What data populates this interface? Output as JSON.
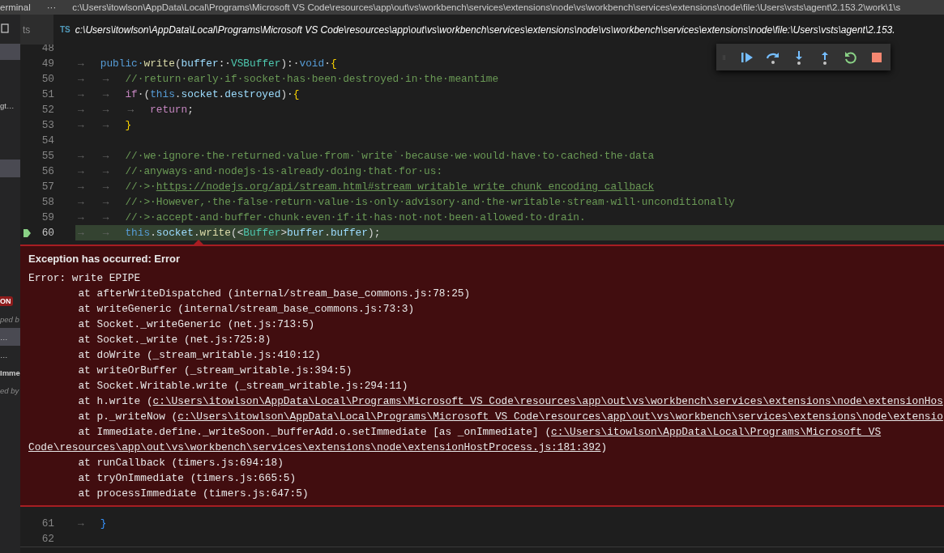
{
  "title_bar": {
    "panel_label": "erminal",
    "more": "···",
    "path": "c:\\Users\\itowlson\\AppData\\Local\\Programs\\Microsoft VS Code\\resources\\app\\out\\vs\\workbench\\services\\extensions\\node\\vs\\workbench\\services\\extensions\\node\\file:\\Users\\vsts\\agent\\2.153.2\\work\\1\\s"
  },
  "sidebar": [
    {
      "kind": "row",
      "selected": true
    },
    {
      "kind": "text",
      "text": "gt…",
      "selected": false
    },
    {
      "kind": "row",
      "selected": true
    },
    {
      "kind": "badge",
      "text": "ON",
      "selected": false
    },
    {
      "kind": "note",
      "text": "ped b",
      "selected": false
    },
    {
      "kind": "text",
      "text": "…",
      "selected": true
    },
    {
      "kind": "text",
      "text": "…",
      "selected": false
    },
    {
      "kind": "strong",
      "text": "Imme",
      "selected": false
    },
    {
      "kind": "note",
      "text": "ed by",
      "selected": false
    }
  ],
  "tabs": [
    {
      "label": "ts",
      "selected": false
    },
    {
      "badge": "TS",
      "label": "c:\\Users\\itowlson\\AppData\\Local\\Programs\\Microsoft VS Code\\resources\\app\\out\\vs\\workbench\\services\\extensions\\node\\vs\\workbench\\services\\extensions\\node\\file:\\Users\\vsts\\agent\\2.153.",
      "selected": true
    }
  ],
  "code_before": [
    {
      "number": "48",
      "current": false
    },
    {
      "number": "49",
      "current": false,
      "tokens": [
        {
          "kind": "tab",
          "text": "→"
        },
        {
          "kind": "keyword",
          "text": "public·"
        },
        {
          "kind": "function",
          "text": "write"
        },
        {
          "kind": "plain",
          "text": "("
        },
        {
          "kind": "variable",
          "text": "buffer"
        },
        {
          "kind": "plain",
          "text": ":·"
        },
        {
          "kind": "type",
          "text": "VSBuffer"
        },
        {
          "kind": "plain",
          "text": "):·"
        },
        {
          "kind": "keyword",
          "text": "void"
        },
        {
          "kind": "plain",
          "text": "·"
        },
        {
          "kind": "brace",
          "text": "{"
        }
      ]
    },
    {
      "number": "50",
      "current": false,
      "tokens": [
        {
          "kind": "tab",
          "text": "→"
        },
        {
          "kind": "tab",
          "text": "→"
        },
        {
          "kind": "comment",
          "text": "//·return·early·if·socket·has·been·destroyed·in·the·meantime"
        }
      ]
    },
    {
      "number": "51",
      "current": false,
      "tokens": [
        {
          "kind": "tab",
          "text": "→"
        },
        {
          "kind": "tab",
          "text": "→"
        },
        {
          "kind": "control",
          "text": "if"
        },
        {
          "kind": "plain",
          "text": "·("
        },
        {
          "kind": "keyword",
          "text": "this"
        },
        {
          "kind": "plain",
          "text": "."
        },
        {
          "kind": "variable",
          "text": "socket"
        },
        {
          "kind": "plain",
          "text": "."
        },
        {
          "kind": "variable",
          "text": "destroyed"
        },
        {
          "kind": "plain",
          "text": ")·"
        },
        {
          "kind": "brace",
          "text": "{"
        }
      ]
    },
    {
      "number": "52",
      "current": false,
      "tokens": [
        {
          "kind": "tab",
          "text": "→"
        },
        {
          "kind": "tab",
          "text": "→"
        },
        {
          "kind": "tab",
          "text": "→"
        },
        {
          "kind": "control",
          "text": "return"
        },
        {
          "kind": "plain",
          "text": ";"
        }
      ]
    },
    {
      "number": "53",
      "current": false,
      "tokens": [
        {
          "kind": "tab",
          "text": "→"
        },
        {
          "kind": "tab",
          "text": "→"
        },
        {
          "kind": "brace",
          "text": "}"
        }
      ]
    },
    {
      "number": "54",
      "current": false
    },
    {
      "number": "55",
      "current": false,
      "tokens": [
        {
          "kind": "tab",
          "text": "→"
        },
        {
          "kind": "tab",
          "text": "→"
        },
        {
          "kind": "comment",
          "text": "//·we·ignore·the·returned·value·from·`write`·because·we·would·have·to·cached·the·data"
        }
      ]
    },
    {
      "number": "56",
      "current": false,
      "tokens": [
        {
          "kind": "tab",
          "text": "→"
        },
        {
          "kind": "tab",
          "text": "→"
        },
        {
          "kind": "comment",
          "text": "//·anyways·and·nodejs·is·already·doing·that·for·us:"
        }
      ]
    },
    {
      "number": "57",
      "current": false,
      "tokens": [
        {
          "kind": "tab",
          "text": "→"
        },
        {
          "kind": "tab",
          "text": "→"
        },
        {
          "kind": "comment",
          "text": "//·>·"
        },
        {
          "kind": "link",
          "text": "https://nodejs.org/api/stream.html#stream_writable_write_chunk_encoding_callback"
        }
      ]
    },
    {
      "number": "58",
      "current": false,
      "tokens": [
        {
          "kind": "tab",
          "text": "→"
        },
        {
          "kind": "tab",
          "text": "→"
        },
        {
          "kind": "comment",
          "text": "//·>·However,·the·false·return·value·is·only·advisory·and·the·writable·stream·will·unconditionally"
        }
      ]
    },
    {
      "number": "59",
      "current": false,
      "tokens": [
        {
          "kind": "tab",
          "text": "→"
        },
        {
          "kind": "tab",
          "text": "→"
        },
        {
          "kind": "comment",
          "text": "//·>·accept·and·buffer·chunk·even·if·it·has·not·not·been·allowed·to·drain."
        }
      ]
    },
    {
      "number": "60",
      "current": true,
      "tokens": [
        {
          "kind": "tab",
          "text": "→"
        },
        {
          "kind": "tab",
          "text": "→"
        },
        {
          "kind": "keyword",
          "text": "this"
        },
        {
          "kind": "plain",
          "text": "."
        },
        {
          "kind": "variable",
          "text": "socket"
        },
        {
          "kind": "plain",
          "text": "."
        },
        {
          "kind": "function",
          "text": "write"
        },
        {
          "kind": "plain",
          "text": "(<"
        },
        {
          "kind": "type",
          "text": "Buffer"
        },
        {
          "kind": "plain",
          "text": ">"
        },
        {
          "kind": "variable",
          "text": "buffer"
        },
        {
          "kind": "plain",
          "text": "."
        },
        {
          "kind": "variable",
          "text": "buffer"
        },
        {
          "kind": "plain",
          "text": ");"
        }
      ]
    }
  ],
  "exception": {
    "title": "Exception has occurred: Error",
    "lines": [
      {
        "kind": "message",
        "text": "Error: write EPIPE"
      },
      {
        "kind": "frame",
        "text": "at afterWriteDispatched (internal/stream_base_commons.js:78:25)"
      },
      {
        "kind": "frame",
        "text": "at writeGeneric (internal/stream_base_commons.js:73:3)"
      },
      {
        "kind": "frame",
        "text": "at Socket._writeGeneric (net.js:713:5)"
      },
      {
        "kind": "frame",
        "text": "at Socket._write (net.js:725:8)"
      },
      {
        "kind": "frame",
        "text": "at doWrite (_stream_writable.js:410:12)"
      },
      {
        "kind": "frame",
        "text": "at writeOrBuffer (_stream_writable.js:394:5)"
      },
      {
        "kind": "frame",
        "text": "at Socket.Writable.write (_stream_writable.js:294:11)"
      },
      {
        "kind": "frame",
        "text": "at h.write (",
        "link": "c:\\Users\\itowlson\\AppData\\Local\\Programs\\Microsoft VS Code\\resources\\app\\out\\vs\\workbench\\services\\extensions\\node\\extensionHos"
      },
      {
        "kind": "frame",
        "text": "at p._writeNow (",
        "link": "c:\\Users\\itowlson\\AppData\\Local\\Programs\\Microsoft VS Code\\resources\\app\\out\\vs\\workbench\\services\\extensions\\node\\extensio"
      },
      {
        "kind": "frame",
        "text": "at Immediate.define._writeSoon._bufferAdd.o.setImmediate [as _onImmediate] (",
        "link": "c:\\Users\\itowlson\\AppData\\Local\\Programs\\Microsoft VS"
      },
      {
        "kind": "continuation",
        "link": "Code\\resources\\app\\out\\vs\\workbench\\services\\extensions\\node\\extensionHostProcess.js:181:392",
        "after": ")"
      },
      {
        "kind": "frame",
        "text": "at runCallback (timers.js:694:18)"
      },
      {
        "kind": "frame",
        "text": "at tryOnImmediate (timers.js:665:5)"
      },
      {
        "kind": "frame",
        "text": "at processImmediate (timers.js:647:5)"
      }
    ]
  },
  "code_after": [
    {
      "number": "61",
      "current": false,
      "tokens": [
        {
          "kind": "tab",
          "text": "→"
        },
        {
          "kind": "brace_close",
          "text": "}"
        }
      ]
    },
    {
      "number": "62",
      "current": false
    }
  ]
}
